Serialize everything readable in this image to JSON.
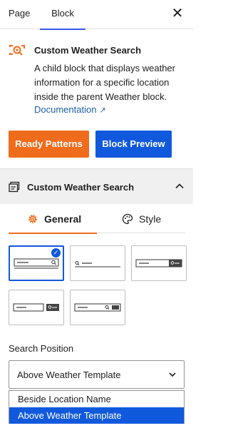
{
  "tabs": {
    "page": "Page",
    "block": "Block"
  },
  "block": {
    "title": "Custom Weather Search",
    "description": "A child block that displays weather information for a specific location inside the parent Weather block.",
    "doc_link": "Documentation",
    "buttons": {
      "ready_patterns": "Ready Patterns",
      "block_preview": "Block Preview"
    }
  },
  "panel": {
    "title": "Custom Weather Search",
    "expanded": true,
    "tabs": {
      "general": "General",
      "style": "Style"
    },
    "active_tab": "General"
  },
  "layout_options": {
    "count": 5,
    "selected_index": 0
  },
  "search_position": {
    "label": "Search Position",
    "value": "Above Weather Template",
    "options": [
      "Beside Location Name",
      "Above Weather Template"
    ],
    "highlighted_option": "Above Weather Template"
  },
  "colors": {
    "accent_blue": "#1159dc",
    "accent_orange": "#f06c1d",
    "tab_underline": "#3858e9",
    "link": "#1c5fa8"
  },
  "icons": {
    "close": "close-icon",
    "block": "weather-search-icon",
    "panel": "panel-block-icon",
    "general": "gear-icon",
    "style": "palette-icon"
  }
}
